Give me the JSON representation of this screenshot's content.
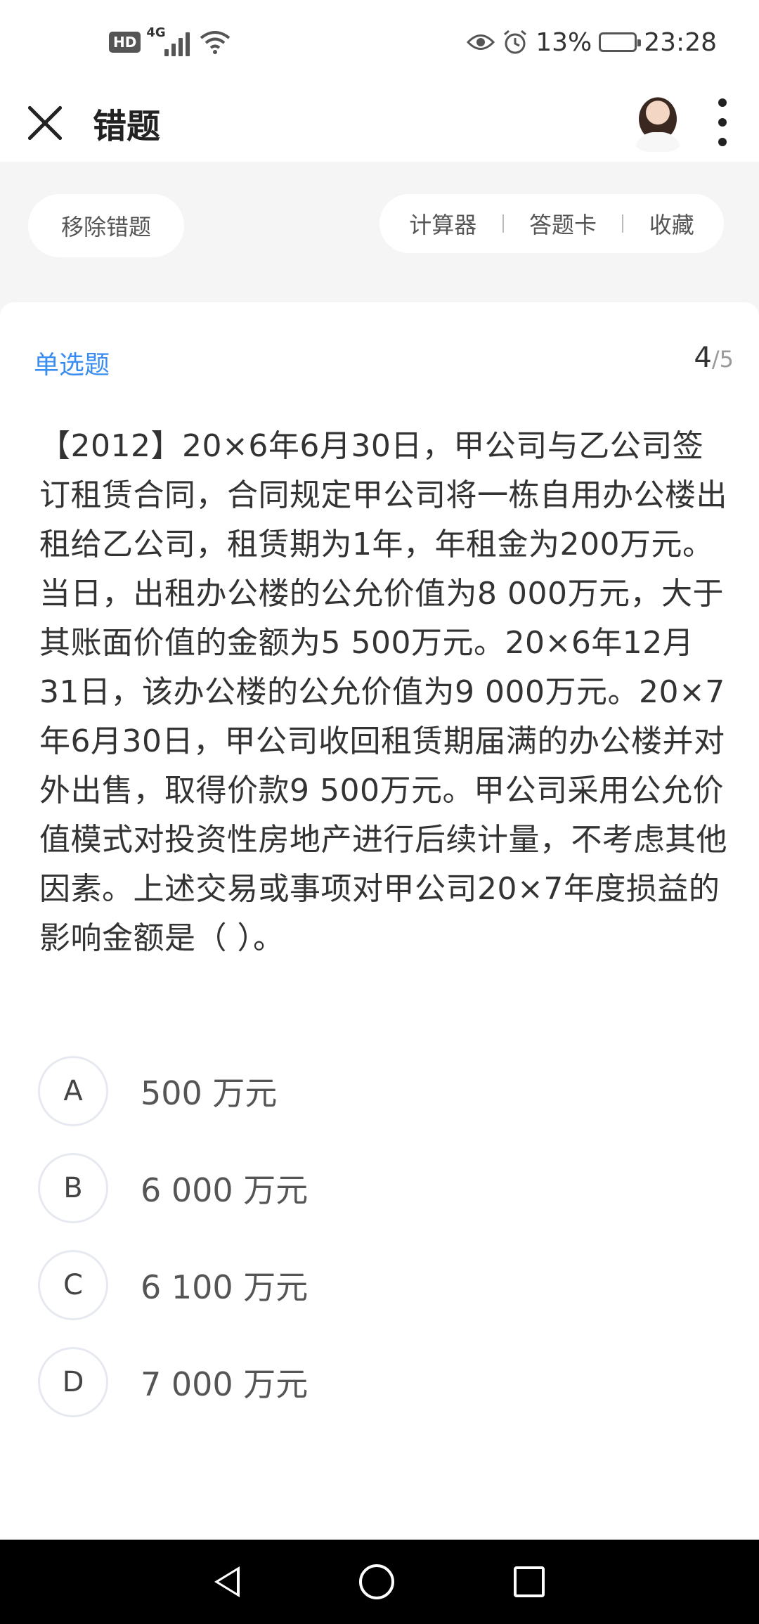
{
  "status_bar": {
    "hd": "HD",
    "network": "4G",
    "battery_percent": "13%",
    "battery_level": 0.13,
    "time": "23:28",
    "icons": [
      "eye-icon",
      "alarm-icon",
      "wifi-icon",
      "signal-icon",
      "battery-icon"
    ]
  },
  "header": {
    "title": "错题",
    "close_icon": "close-icon",
    "more_icon": "more-vertical-icon"
  },
  "actions": {
    "remove_label": "移除错题",
    "calculator_label": "计算器",
    "answer_card_label": "答题卡",
    "favorite_label": "收藏"
  },
  "question": {
    "type": "单选题",
    "current": "4",
    "total": "/5",
    "text": "【2012】20×6年6月30日，甲公司与乙公司签订租赁合同，合同规定甲公司将一栋自用办公楼出租给乙公司，租赁期为1年，年租金为200万元。当日，出租办公楼的公允价值为8 000万元，大于其账面价值的金额为5 500万元。20×6年12月31日，该办公楼的公允价值为9 000万元。20×7年6月30日，甲公司收回租赁期届满的办公楼并对外出售，取得价款9 500万元。甲公司采用公允价值模式对投资性房地产进行后续计量，不考虑其他因素。上述交易或事项对甲公司20×7年度损益的影响金额是（    ）。",
    "options": [
      {
        "letter": "A",
        "text": "500 万元"
      },
      {
        "letter": "B",
        "text": "6 000 万元"
      },
      {
        "letter": "C",
        "text": "6 100 万元"
      },
      {
        "letter": "D",
        "text": "7 000 万元"
      }
    ]
  },
  "colors": {
    "accent": "#3a8df0",
    "background": "#f5f5f5",
    "battery_low": "#f0a020"
  }
}
